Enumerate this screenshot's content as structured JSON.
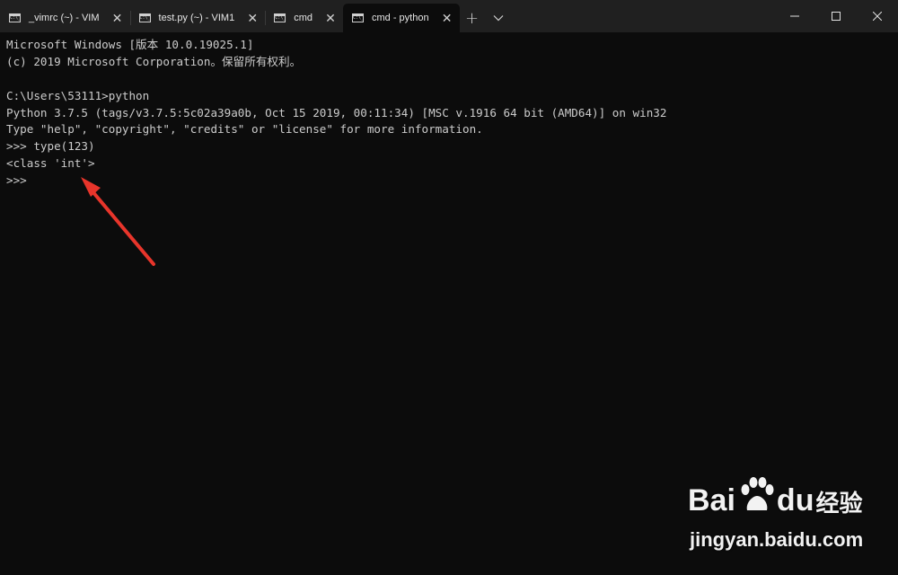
{
  "tabs": [
    {
      "label": "_vimrc (~) - VIM",
      "active": false
    },
    {
      "label": "test.py (~) - VIM1",
      "active": false
    },
    {
      "label": "cmd",
      "active": false
    },
    {
      "label": "cmd - python",
      "active": true
    }
  ],
  "tab_icon": "console-icon",
  "tab_close_glyph": "✕",
  "new_tab_glyph": "+",
  "window_controls": [
    "minimize-icon",
    "maximize-icon",
    "close-icon"
  ],
  "terminal": {
    "lines": [
      "Microsoft Windows [版本 10.0.19025.1]",
      "(c) 2019 Microsoft Corporation。保留所有权利。",
      "",
      "C:\\Users\\53111>python",
      "Python 3.7.5 (tags/v3.7.5:5c02a39a0b, Oct 15 2019, 00:11:34) [MSC v.1916 64 bit (AMD64)] on win32",
      "Type \"help\", \"copyright\", \"credits\" or \"license\" for more information.",
      ">>> type(123)",
      "<class 'int'>",
      ">>>"
    ],
    "text_color": "#cccccc",
    "background": "#0c0c0c"
  },
  "annotation": {
    "color": "#e8352b"
  },
  "watermark": {
    "brand_left": "Bai",
    "brand_right": "du",
    "product": "经验",
    "url": "jingyan.baidu.com"
  },
  "colors": {
    "titlebar": "#202020",
    "active_tab": "#0c0c0c",
    "tab_text": "#e6e6e6"
  }
}
